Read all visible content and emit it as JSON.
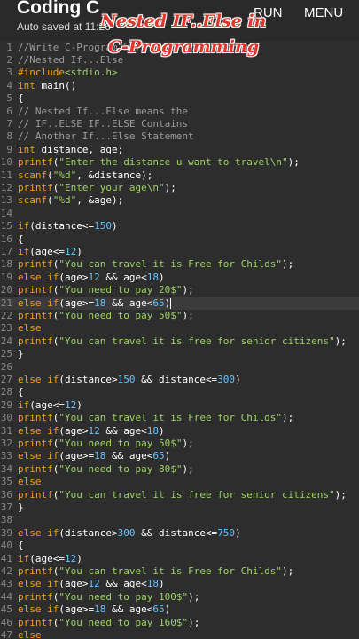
{
  "appbar": {
    "title": "Coding C",
    "autosave": "Auto saved at 11:26",
    "run_label": "RUN",
    "menu_label": "MENU"
  },
  "overlay": {
    "line1": "Nested IF..Else in",
    "line2": "C-Programming"
  },
  "editor": {
    "highlight_line": 21,
    "colors": {
      "comment": "#9b9b9b",
      "keyword": "#f39c12",
      "string": "#9cd164",
      "number": "#66c2ff",
      "text": "#ffffff",
      "line_number": "#8a8a8a"
    },
    "lines": [
      {
        "n": "1",
        "tokens": [
          [
            "c",
            "//Write C-Program here"
          ]
        ]
      },
      {
        "n": "2",
        "tokens": [
          [
            "c",
            "//Nested If...Else"
          ]
        ]
      },
      {
        "n": "3",
        "tokens": [
          [
            "p",
            "#include"
          ],
          [
            "s",
            "<stdio.h>"
          ]
        ]
      },
      {
        "n": "4",
        "tokens": [
          [
            "k",
            "int"
          ],
          [
            "t",
            " main()"
          ]
        ]
      },
      {
        "n": "5",
        "tokens": [
          [
            "t",
            "{"
          ]
        ]
      },
      {
        "n": "6",
        "tokens": [
          [
            "c",
            "// Nested If...Else means the"
          ]
        ]
      },
      {
        "n": "7",
        "tokens": [
          [
            "c",
            "// IF..ELSE IF..ELSE Contains"
          ]
        ]
      },
      {
        "n": "8",
        "tokens": [
          [
            "c",
            "// Another If...Else Statement"
          ]
        ]
      },
      {
        "n": "9",
        "tokens": [
          [
            "k",
            "int"
          ],
          [
            "t",
            " distance, age;"
          ]
        ]
      },
      {
        "n": "10",
        "tokens": [
          [
            "k",
            "printf"
          ],
          [
            "t",
            "("
          ],
          [
            "s",
            "\"Enter the distance u want to travel\\n\""
          ],
          [
            "t",
            ");"
          ]
        ]
      },
      {
        "n": "11",
        "tokens": [
          [
            "k",
            "scanf"
          ],
          [
            "t",
            "("
          ],
          [
            "s",
            "\"%d\""
          ],
          [
            "t",
            ", &distance);"
          ]
        ]
      },
      {
        "n": "12",
        "tokens": [
          [
            "k",
            "printf"
          ],
          [
            "t",
            "("
          ],
          [
            "s",
            "\"Enter your age\\n\""
          ],
          [
            "t",
            ");"
          ]
        ]
      },
      {
        "n": "13",
        "tokens": [
          [
            "k",
            "scanf"
          ],
          [
            "t",
            "("
          ],
          [
            "s",
            "\"%d\""
          ],
          [
            "t",
            ", &age);"
          ]
        ]
      },
      {
        "n": "14",
        "tokens": []
      },
      {
        "n": "15",
        "tokens": [
          [
            "k",
            "if"
          ],
          [
            "t",
            "(distance<="
          ],
          [
            "n",
            "150"
          ],
          [
            "t",
            ")"
          ]
        ]
      },
      {
        "n": "16",
        "tokens": [
          [
            "t",
            "{"
          ]
        ]
      },
      {
        "n": "17",
        "tokens": [
          [
            "k",
            "if"
          ],
          [
            "t",
            "(age<="
          ],
          [
            "n",
            "12"
          ],
          [
            "t",
            ")"
          ]
        ]
      },
      {
        "n": "18",
        "tokens": [
          [
            "k",
            "printf"
          ],
          [
            "t",
            "("
          ],
          [
            "s",
            "\"You can travel it is Free for Childs\""
          ],
          [
            "t",
            ");"
          ]
        ]
      },
      {
        "n": "19",
        "tokens": [
          [
            "k",
            "else if"
          ],
          [
            "t",
            "(age>"
          ],
          [
            "n",
            "12"
          ],
          [
            "t",
            " && age<"
          ],
          [
            "n",
            "18"
          ],
          [
            "t",
            ")"
          ]
        ]
      },
      {
        "n": "20",
        "tokens": [
          [
            "k",
            "printf"
          ],
          [
            "t",
            "("
          ],
          [
            "s",
            "\"You need to pay 20$\""
          ],
          [
            "t",
            ");"
          ]
        ]
      },
      {
        "n": "21",
        "tokens": [
          [
            "k",
            "else if"
          ],
          [
            "t",
            "(age>="
          ],
          [
            "n",
            "18"
          ],
          [
            "t",
            " && age<"
          ],
          [
            "n",
            "65"
          ],
          [
            "t",
            ")"
          ]
        ]
      },
      {
        "n": "22",
        "tokens": [
          [
            "k",
            "printf"
          ],
          [
            "t",
            "("
          ],
          [
            "s",
            "\"You need to pay 50$\""
          ],
          [
            "t",
            ");"
          ]
        ]
      },
      {
        "n": "23",
        "tokens": [
          [
            "k",
            "else"
          ]
        ]
      },
      {
        "n": "24",
        "tokens": [
          [
            "k",
            "printf"
          ],
          [
            "t",
            "("
          ],
          [
            "s",
            "\"You can travel it is free for senior citizens\""
          ],
          [
            "t",
            ");"
          ]
        ]
      },
      {
        "n": "25",
        "tokens": [
          [
            "t",
            "}"
          ]
        ]
      },
      {
        "n": "26",
        "tokens": []
      },
      {
        "n": "27",
        "tokens": [
          [
            "k",
            "else if"
          ],
          [
            "t",
            "(distance>"
          ],
          [
            "n",
            "150"
          ],
          [
            "t",
            " && distance<="
          ],
          [
            "n",
            "300"
          ],
          [
            "t",
            ")"
          ]
        ]
      },
      {
        "n": "28",
        "tokens": [
          [
            "t",
            "{"
          ]
        ]
      },
      {
        "n": "29",
        "tokens": [
          [
            "k",
            "if"
          ],
          [
            "t",
            "(age<="
          ],
          [
            "n",
            "12"
          ],
          [
            "t",
            ")"
          ]
        ]
      },
      {
        "n": "30",
        "tokens": [
          [
            "k",
            "printf"
          ],
          [
            "t",
            "("
          ],
          [
            "s",
            "\"You can travel it is Free for Childs\""
          ],
          [
            "t",
            ");"
          ]
        ]
      },
      {
        "n": "31",
        "tokens": [
          [
            "k",
            "else if"
          ],
          [
            "t",
            "(age>"
          ],
          [
            "n",
            "12"
          ],
          [
            "t",
            " && age<"
          ],
          [
            "n",
            "18"
          ],
          [
            "t",
            ")"
          ]
        ]
      },
      {
        "n": "32",
        "tokens": [
          [
            "k",
            "printf"
          ],
          [
            "t",
            "("
          ],
          [
            "s",
            "\"You need to pay 50$\""
          ],
          [
            "t",
            ");"
          ]
        ]
      },
      {
        "n": "33",
        "tokens": [
          [
            "k",
            "else if"
          ],
          [
            "t",
            "(age>="
          ],
          [
            "n",
            "18"
          ],
          [
            "t",
            " && age<"
          ],
          [
            "n",
            "65"
          ],
          [
            "t",
            ")"
          ]
        ]
      },
      {
        "n": "34",
        "tokens": [
          [
            "k",
            "printf"
          ],
          [
            "t",
            "("
          ],
          [
            "s",
            "\"You need to pay 80$\""
          ],
          [
            "t",
            ");"
          ]
        ]
      },
      {
        "n": "35",
        "tokens": [
          [
            "k",
            "else"
          ]
        ]
      },
      {
        "n": "36",
        "tokens": [
          [
            "k",
            "printf"
          ],
          [
            "t",
            "("
          ],
          [
            "s",
            "\"You can travel it is free for senior citizens\""
          ],
          [
            "t",
            ");"
          ]
        ]
      },
      {
        "n": "37",
        "tokens": [
          [
            "t",
            "}"
          ]
        ]
      },
      {
        "n": "38",
        "tokens": []
      },
      {
        "n": "39",
        "tokens": [
          [
            "k",
            "else if"
          ],
          [
            "t",
            "(distance>"
          ],
          [
            "n",
            "300"
          ],
          [
            "t",
            " && distance<="
          ],
          [
            "n",
            "750"
          ],
          [
            "t",
            ")"
          ]
        ]
      },
      {
        "n": "40",
        "tokens": [
          [
            "t",
            "{"
          ]
        ]
      },
      {
        "n": "41",
        "tokens": [
          [
            "k",
            "if"
          ],
          [
            "t",
            "(age<="
          ],
          [
            "n",
            "12"
          ],
          [
            "t",
            ")"
          ]
        ]
      },
      {
        "n": "42",
        "tokens": [
          [
            "k",
            "printf"
          ],
          [
            "t",
            "("
          ],
          [
            "s",
            "\"You can travel it is Free for Childs\""
          ],
          [
            "t",
            ");"
          ]
        ]
      },
      {
        "n": "43",
        "tokens": [
          [
            "k",
            "else if"
          ],
          [
            "t",
            "(age>"
          ],
          [
            "n",
            "12"
          ],
          [
            "t",
            " && age<"
          ],
          [
            "n",
            "18"
          ],
          [
            "t",
            ")"
          ]
        ]
      },
      {
        "n": "44",
        "tokens": [
          [
            "k",
            "printf"
          ],
          [
            "t",
            "("
          ],
          [
            "s",
            "\"You need to pay 100$\""
          ],
          [
            "t",
            ");"
          ]
        ]
      },
      {
        "n": "45",
        "tokens": [
          [
            "k",
            "else if"
          ],
          [
            "t",
            "(age>="
          ],
          [
            "n",
            "18"
          ],
          [
            "t",
            " && age<"
          ],
          [
            "n",
            "65"
          ],
          [
            "t",
            ")"
          ]
        ]
      },
      {
        "n": "46",
        "tokens": [
          [
            "k",
            "printf"
          ],
          [
            "t",
            "("
          ],
          [
            "s",
            "\"You need to pay 160$\""
          ],
          [
            "t",
            ");"
          ]
        ]
      },
      {
        "n": "47",
        "tokens": [
          [
            "k",
            "else"
          ]
        ]
      }
    ]
  }
}
